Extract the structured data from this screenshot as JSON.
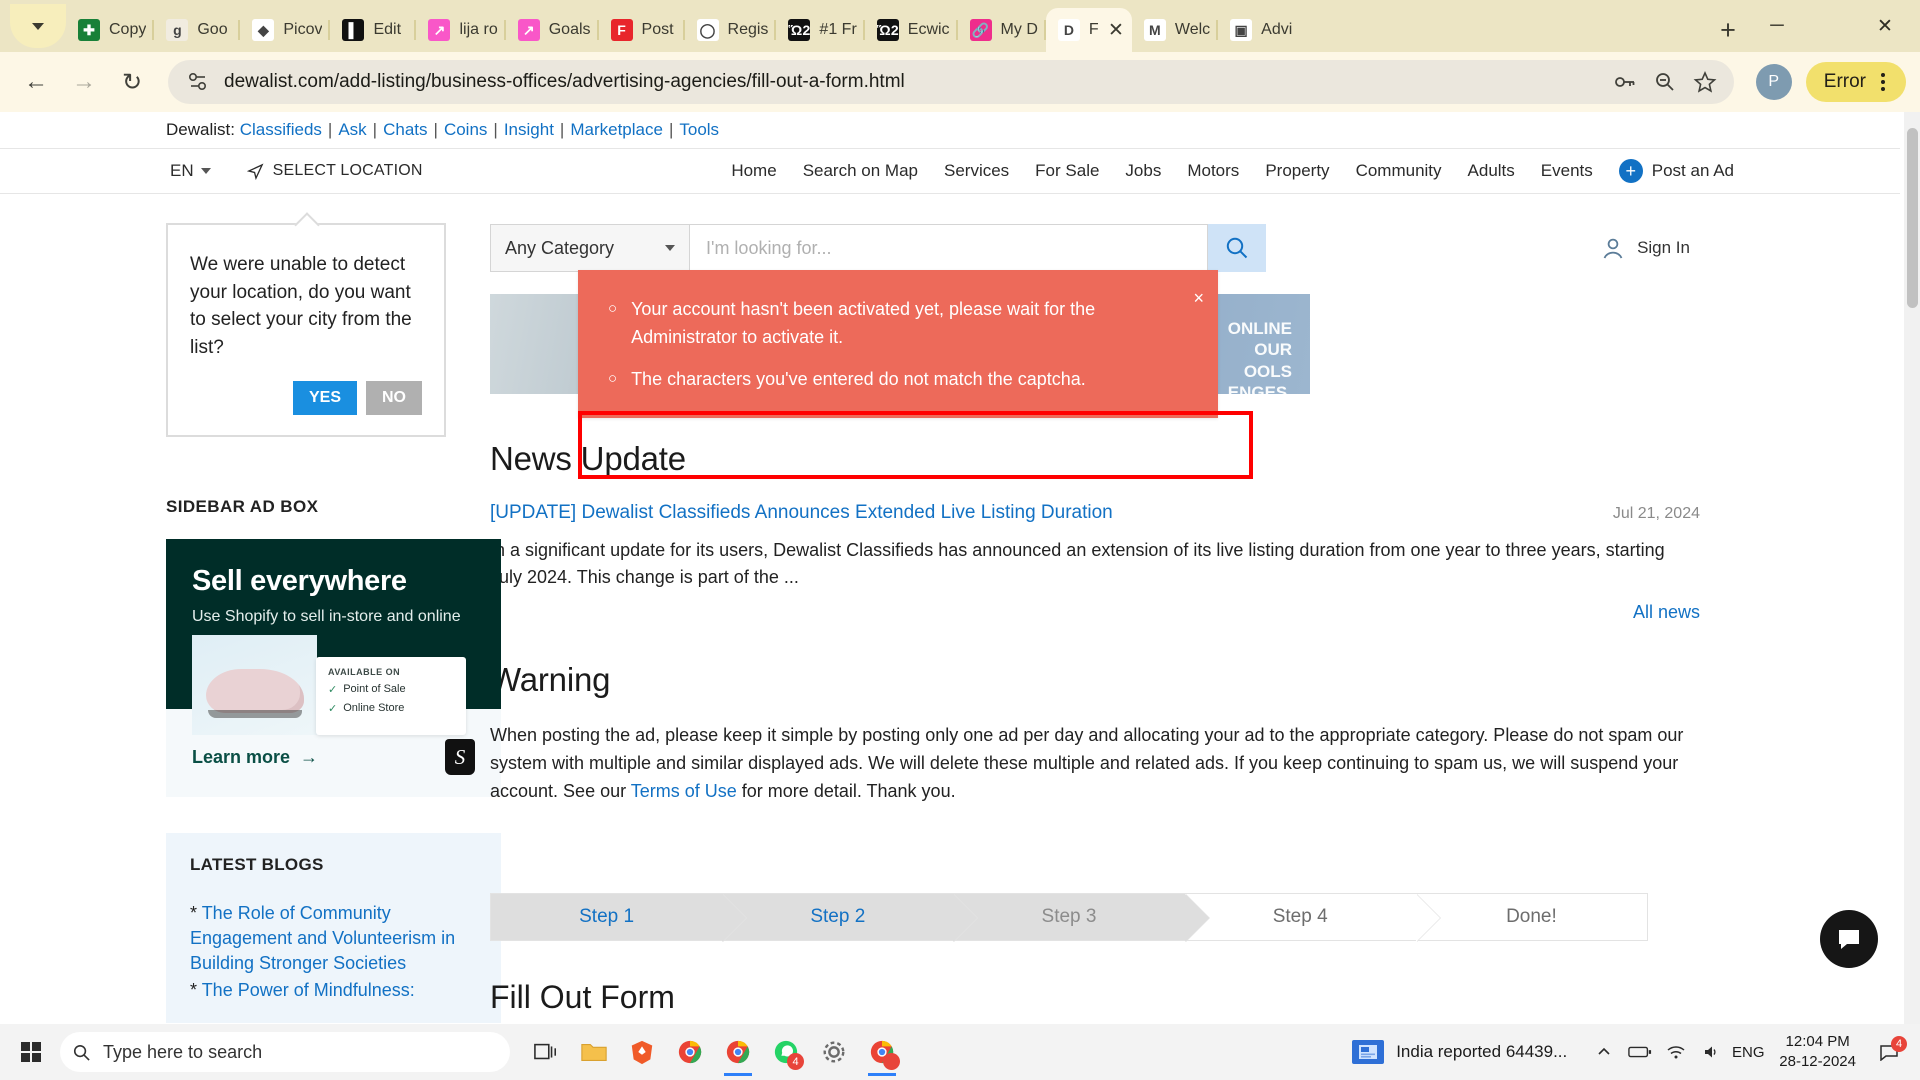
{
  "browser": {
    "tabs": [
      {
        "label": "Copy",
        "icon": "sheets-icon",
        "bg": "#188038",
        "glyph": "✚",
        "active": false
      },
      {
        "label": "Goo",
        "icon": "google-doc-icon",
        "bg": "#f1ece0",
        "glyph": "g",
        "active": false
      },
      {
        "label": "Picov",
        "icon": "picovoice-icon",
        "bg": "#ffffff",
        "glyph": "◆",
        "active": false
      },
      {
        "label": "Edit",
        "icon": "editor-icon",
        "bg": "#111111",
        "glyph": "▌",
        "active": false
      },
      {
        "label": "lija ro",
        "icon": "chart-icon",
        "bg": "#f957c8",
        "glyph": "↗",
        "active": false
      },
      {
        "label": "Goals",
        "icon": "chart-icon",
        "bg": "#f957c8",
        "glyph": "↗",
        "active": false
      },
      {
        "label": "Post",
        "icon": "fotor-icon",
        "bg": "#e8262b",
        "glyph": "F",
        "active": false
      },
      {
        "label": "Regis",
        "icon": "oval-icon",
        "bg": "#ffffff",
        "glyph": "◯",
        "active": false
      },
      {
        "label": "#1 Fr",
        "icon": "cart-icon",
        "bg": "#111111",
        "glyph": "Ὥ2",
        "active": false
      },
      {
        "label": "Ecwic",
        "icon": "cart-icon",
        "bg": "#111111",
        "glyph": "Ὥ2",
        "active": false
      },
      {
        "label": "My D",
        "icon": "link-icon",
        "bg": "#ef2d8c",
        "glyph": "🔗",
        "active": false
      },
      {
        "label": "F",
        "icon": "dewalist-icon",
        "bg": "#ffffff",
        "glyph": "D",
        "active": true
      },
      {
        "label": "Welc",
        "icon": "gmail-icon",
        "bg": "#ffffff",
        "glyph": "M",
        "active": false
      },
      {
        "label": "Advi",
        "icon": "photo-icon",
        "bg": "#ffffff",
        "glyph": "▣",
        "active": false
      }
    ],
    "new_tab_label": "+",
    "window_controls": {
      "minimize": "─",
      "maximize": "☐",
      "close": "✕"
    },
    "url": "dewalist.com/add-listing/business-offices/advertising-agencies/fill-out-a-form.html",
    "error_pill_label": "Error",
    "profile_initial": "P",
    "back_glyph": "←",
    "forward_glyph": "→",
    "reload_glyph": "↻"
  },
  "site_topbar": {
    "brand": "Dewalist:",
    "links": [
      "Classifieds",
      "Ask",
      "Chats",
      "Coins",
      "Insight",
      "Marketplace",
      "Tools"
    ]
  },
  "site_nav": {
    "language": "EN",
    "select_location": "SELECT LOCATION",
    "menu": [
      "Home",
      "Search on Map",
      "Services",
      "For Sale",
      "Jobs",
      "Motors",
      "Property",
      "Community",
      "Adults",
      "Events"
    ],
    "post_ad": "Post an Ad"
  },
  "location_popup": {
    "message": "We were unable to detect your location, do you want to select your city from the list?",
    "yes": "YES",
    "no": "NO"
  },
  "search": {
    "category": "Any Category",
    "placeholder": "I'm looking for...",
    "sign_in": "Sign In"
  },
  "banner": {
    "text_line1": "ONLINE",
    "text_line2": "OUR",
    "text_line3": "OOLS",
    "text_line4": "ENGES."
  },
  "alert": {
    "messages": [
      "Your account hasn't been activated yet, please wait for the Administrator to activate it.",
      "The characters you've entered do not match the captcha."
    ],
    "close": "×"
  },
  "news": {
    "heading": "News Update",
    "title": "[UPDATE] Dewalist Classifieds Announces Extended Live Listing Duration",
    "date": "Jul 21, 2024",
    "excerpt": "In a significant update for its users, Dewalist Classifieds has announced an extension of its live listing duration from one year to three years, starting July 2024. This change is part of the ...",
    "all_news": "All news"
  },
  "warning": {
    "heading": "Warning",
    "text_before": "When posting the ad, please keep it simple by posting only one ad per day and allocating your ad to the appropriate category. Please do not spam our system with multiple and similar displayed ads. We will delete these multiple and related ads. If you keep continuing to spam us, we will suspend your account. See our ",
    "link": "Terms of Use",
    "text_after": " for more detail. Thank you."
  },
  "sidebar": {
    "ad_label": "SIDEBAR AD BOX",
    "ad": {
      "title": "Sell everywhere",
      "subtitle": "Use Shopify to sell in-store and online",
      "card_title": "AVAILABLE ON",
      "card_items": [
        "Point of Sale",
        "Online Store"
      ],
      "cta": "Learn more"
    },
    "blogs_label": "LATEST BLOGS",
    "blogs": [
      "The Role of Community Engagement and Volunteerism in Building Stronger Societies",
      "The Power of Mindfulness:"
    ]
  },
  "wizard": {
    "steps": [
      {
        "label": "Step 1",
        "state": "done"
      },
      {
        "label": "Step 2",
        "state": "done"
      },
      {
        "label": "Step 3",
        "state": "current"
      },
      {
        "label": "Step 4",
        "state": "future"
      },
      {
        "label": "Done!",
        "state": "future"
      }
    ],
    "form_title": "Fill Out Form"
  },
  "taskbar": {
    "search_placeholder": "Type here to search",
    "news_text": "India reported 64439...",
    "language": "ENG",
    "time": "12:04 PM",
    "date": "28-12-2024",
    "whatsapp_badge": "4",
    "chrome_badge": "",
    "notification_badge": "4"
  },
  "colors": {
    "accent_blue": "#1271c4",
    "alert_red": "#ed6a5a",
    "highlight_red": "#ff0000",
    "tab_bg": "#ece5c4",
    "toolbar_bg": "#fdf7e6"
  }
}
